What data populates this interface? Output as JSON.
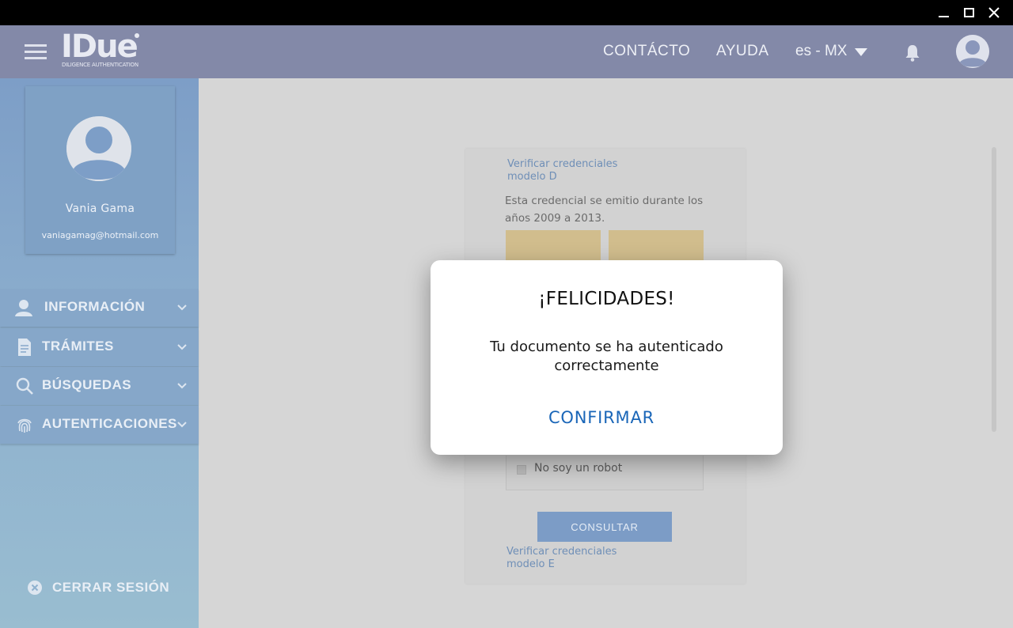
{
  "header": {
    "logo_text": "IDue",
    "logo_subtitle": "DILIGENCE AUTHENTICATION",
    "nav_contact": "CONTÁCTO",
    "nav_help": "AYUDA",
    "language": "es - MX"
  },
  "sidebar": {
    "profile": {
      "name": "Vania Gama",
      "email": "vaniagamag@hotmail.com"
    },
    "items": [
      {
        "label": "INFORMACIÓN",
        "icon": "person-icon"
      },
      {
        "label": "TRÁMITES",
        "icon": "document-icon"
      },
      {
        "label": "BÚSQUEDAS",
        "icon": "search-icon"
      },
      {
        "label": "AUTENTICACIONES",
        "icon": "fingerprint-icon"
      }
    ],
    "logout_label": "CERRAR SESIÓN"
  },
  "main": {
    "link_top": "Verificar credenciales modelo D",
    "description": "Esta credencial se emitio durante los años 2009 a 2013.",
    "captcha_label": "No soy un robot",
    "consult_label": "CONSULTAR",
    "link_bottom": "Verificar credenciales modelo E"
  },
  "dialog": {
    "title": "¡FELICIDADES!",
    "message": "Tu documento se ha autenticado correctamente",
    "confirm_label": "CONFIRMAR"
  },
  "colors": {
    "header_bg": "#8389a8",
    "sidebar_bg": "#86a7c9",
    "accent": "#1a66b8",
    "credential_gold": "#d1bd8d"
  }
}
